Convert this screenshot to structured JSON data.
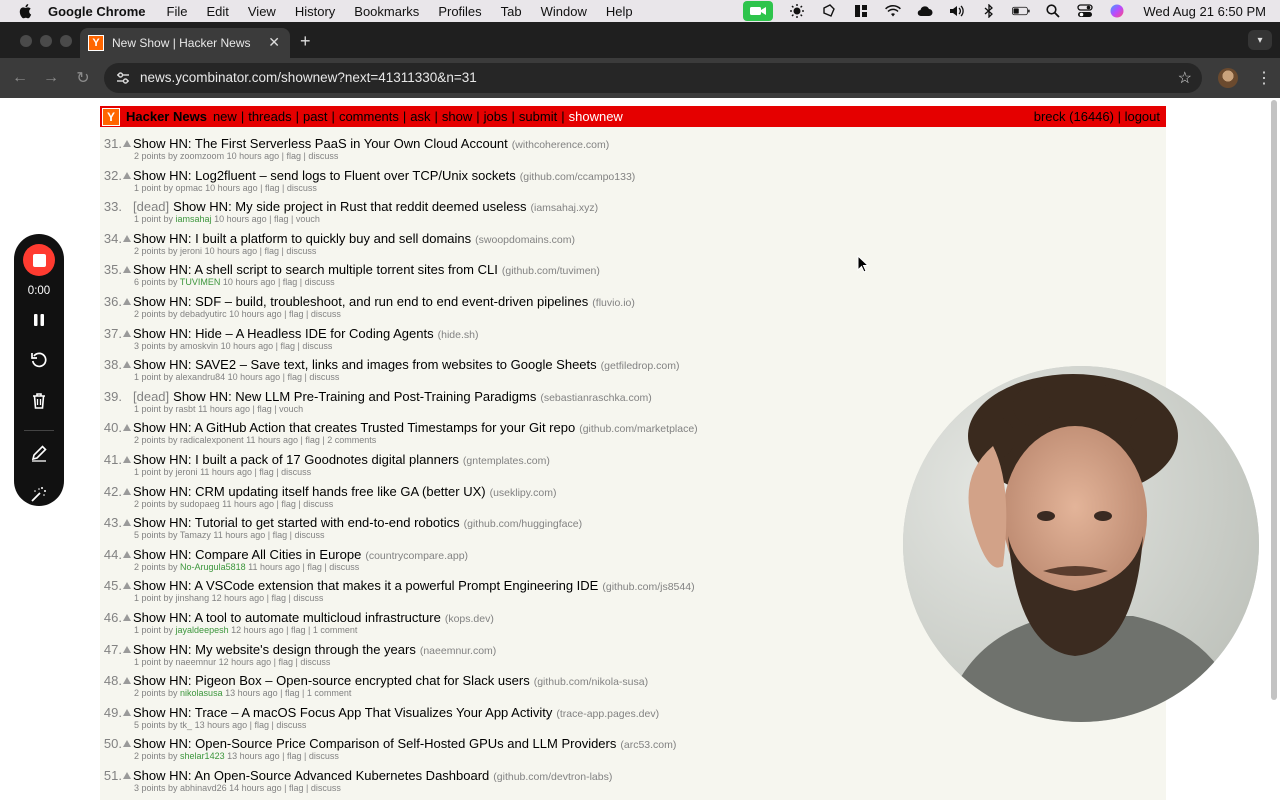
{
  "menubar": {
    "app": "Google Chrome",
    "items": [
      "File",
      "Edit",
      "View",
      "History",
      "Bookmarks",
      "Profiles",
      "Tab",
      "Window",
      "Help"
    ],
    "clock": "Wed Aug 21  6:50 PM"
  },
  "browser": {
    "tab_title": "New Show | Hacker News",
    "favicon_letter": "Y",
    "url": "news.ycombinator.com/shownew?next=41311330&n=31"
  },
  "hn": {
    "logo": "Y",
    "name": "Hacker News",
    "nav": [
      "new",
      "threads",
      "past",
      "comments",
      "ask",
      "show",
      "jobs",
      "submit"
    ],
    "current": "shownew",
    "user": "breck (16446)",
    "logout": "logout",
    "items": [
      {
        "rank": "31.",
        "dead": "",
        "title": "Show HN: The First Serverless PaaS in Your Own Cloud Account",
        "site": "(withcoherence.com)",
        "points": "2 points by",
        "user": "zoomzoom",
        "green": false,
        "time": "10 hours ago",
        "flag": "flag",
        "extra": "discuss"
      },
      {
        "rank": "32.",
        "dead": "",
        "title": "Show HN: Log2fluent – send logs to Fluent over TCP/Unix sockets",
        "site": "(github.com/ccampo133)",
        "points": "1 point by",
        "user": "opmac",
        "green": false,
        "time": "10 hours ago",
        "flag": "flag",
        "extra": "discuss"
      },
      {
        "rank": "33.",
        "dead": "[dead]",
        "title": "Show HN: My side project in Rust that reddit deemed useless",
        "site": "(iamsahaj.xyz)",
        "points": "1 point by",
        "user": "iamsahaj",
        "green": true,
        "time": "10 hours ago",
        "flag": "flag",
        "extra": "vouch"
      },
      {
        "rank": "34.",
        "dead": "",
        "title": "Show HN: I built a platform to quickly buy and sell domains",
        "site": "(swoopdomains.com)",
        "points": "2 points by",
        "user": "jeroni",
        "green": false,
        "time": "10 hours ago",
        "flag": "flag",
        "extra": "discuss"
      },
      {
        "rank": "35.",
        "dead": "",
        "title": "Show HN: A shell script to search multiple torrent sites from CLI",
        "site": "(github.com/tuvimen)",
        "points": "6 points by",
        "user": "TUVIMEN",
        "green": true,
        "time": "10 hours ago",
        "flag": "flag",
        "extra": "discuss"
      },
      {
        "rank": "36.",
        "dead": "",
        "title": "Show HN: SDF – build, troubleshoot, and run end to end event-driven pipelines",
        "site": "(fluvio.io)",
        "points": "2 points by",
        "user": "debadyutirc",
        "green": false,
        "time": "10 hours ago",
        "flag": "flag",
        "extra": "discuss"
      },
      {
        "rank": "37.",
        "dead": "",
        "title": "Show HN: Hide – A Headless IDE for Coding Agents",
        "site": "(hide.sh)",
        "points": "3 points by",
        "user": "amoskvin",
        "green": false,
        "time": "10 hours ago",
        "flag": "flag",
        "extra": "discuss"
      },
      {
        "rank": "38.",
        "dead": "",
        "title": "Show HN: SAVE2 – Save text, links and images from websites to Google Sheets",
        "site": "(getfiledrop.com)",
        "points": "1 point by",
        "user": "alexandru84",
        "green": false,
        "time": "10 hours ago",
        "flag": "flag",
        "extra": "discuss"
      },
      {
        "rank": "39.",
        "dead": "[dead]",
        "title": "Show HN: New LLM Pre-Training and Post-Training Paradigms",
        "site": "(sebastianraschka.com)",
        "points": "1 point by",
        "user": "rasbt",
        "green": false,
        "time": "11 hours ago",
        "flag": "flag",
        "extra": "vouch"
      },
      {
        "rank": "40.",
        "dead": "",
        "title": "Show HN: A GitHub Action that creates Trusted Timestamps for your Git repo",
        "site": "(github.com/marketplace)",
        "points": "2 points by",
        "user": "radicalexponent",
        "green": false,
        "time": "11 hours ago",
        "flag": "flag",
        "extra": "2 comments"
      },
      {
        "rank": "41.",
        "dead": "",
        "title": "Show HN: I built a pack of 17 Goodnotes digital planners",
        "site": "(gntemplates.com)",
        "points": "1 point by",
        "user": "jeroni",
        "green": false,
        "time": "11 hours ago",
        "flag": "flag",
        "extra": "discuss"
      },
      {
        "rank": "42.",
        "dead": "",
        "title": "Show HN: CRM updating itself hands free like GA (better UX)",
        "site": "(useklipy.com)",
        "points": "2 points by",
        "user": "sudopaeg",
        "green": false,
        "time": "11 hours ago",
        "flag": "flag",
        "extra": "discuss"
      },
      {
        "rank": "43.",
        "dead": "",
        "title": "Show HN: Tutorial to get started with end-to-end robotics",
        "site": "(github.com/huggingface)",
        "points": "5 points by",
        "user": "Tamazy",
        "green": false,
        "time": "11 hours ago",
        "flag": "flag",
        "extra": "discuss"
      },
      {
        "rank": "44.",
        "dead": "",
        "title": "Show HN: Compare All Cities in Europe",
        "site": "(countrycompare.app)",
        "points": "2 points by",
        "user": "No-Arugula5818",
        "green": true,
        "time": "11 hours ago",
        "flag": "flag",
        "extra": "discuss"
      },
      {
        "rank": "45.",
        "dead": "",
        "title": "Show HN: A VSCode extension that makes it a powerful Prompt Engineering IDE",
        "site": "(github.com/js8544)",
        "points": "1 point by",
        "user": "jinshang",
        "green": false,
        "time": "12 hours ago",
        "flag": "flag",
        "extra": "discuss"
      },
      {
        "rank": "46.",
        "dead": "",
        "title": "Show HN: A tool to automate multicloud infrastructure",
        "site": "(kops.dev)",
        "points": "1 point by",
        "user": "jayaldeepesh",
        "green": true,
        "time": "12 hours ago",
        "flag": "flag",
        "extra": "1 comment"
      },
      {
        "rank": "47.",
        "dead": "",
        "title": "Show HN: My website's design through the years",
        "site": "(naeemnur.com)",
        "points": "1 point by",
        "user": "naeemnur",
        "green": false,
        "time": "12 hours ago",
        "flag": "flag",
        "extra": "discuss"
      },
      {
        "rank": "48.",
        "dead": "",
        "title": "Show HN: Pigeon Box – Open-source encrypted chat for Slack users",
        "site": "(github.com/nikola-susa)",
        "points": "2 points by",
        "user": "nikolasusa",
        "green": true,
        "time": "13 hours ago",
        "flag": "flag",
        "extra": "1 comment"
      },
      {
        "rank": "49.",
        "dead": "",
        "title": "Show HN: Trace – A macOS Focus App That Visualizes Your App Activity",
        "site": "(trace-app.pages.dev)",
        "points": "5 points by",
        "user": "tk_",
        "green": false,
        "time": "13 hours ago",
        "flag": "flag",
        "extra": "discuss"
      },
      {
        "rank": "50.",
        "dead": "",
        "title": "Show HN: Open-Source Price Comparison of Self-Hosted GPUs and LLM Providers",
        "site": "(arc53.com)",
        "points": "2 points by",
        "user": "shelar1423",
        "green": true,
        "time": "13 hours ago",
        "flag": "flag",
        "extra": "discuss"
      },
      {
        "rank": "51.",
        "dead": "",
        "title": "Show HN: An Open-Source Advanced Kubernetes Dashboard",
        "site": "(github.com/devtron-labs)",
        "points": "3 points by",
        "user": "abhinavd26",
        "green": false,
        "time": "14 hours ago",
        "flag": "flag",
        "extra": "discuss"
      }
    ]
  },
  "recorder": {
    "time": "0:00"
  },
  "colors": {
    "hn_bar": "#e50000",
    "hn_bg": "#f6f6ef",
    "green_user": "#3c963c",
    "record_red": "#ff3b30"
  },
  "icons": [
    "apple-icon",
    "facetime-icon",
    "search-icon",
    "wifi-icon",
    "bluetooth-icon",
    "battery-icon",
    "star-icon",
    "record-stop-icon",
    "pause-icon",
    "restart-icon",
    "trash-icon",
    "pencil-icon",
    "effects-icon",
    "mouse-cursor-icon"
  ]
}
